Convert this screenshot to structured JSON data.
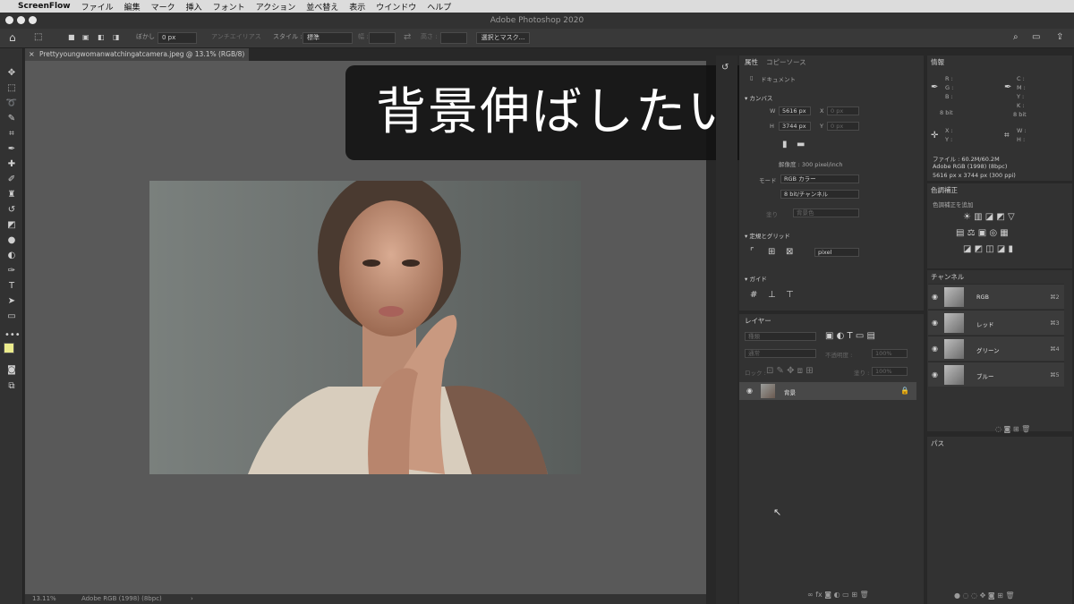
{
  "menubar": {
    "apple": "",
    "app": "ScreenFlow",
    "items": [
      "ファイル",
      "編集",
      "マーク",
      "挿入",
      "フォント",
      "アクション",
      "並べ替え",
      "表示",
      "ウインドウ",
      "ヘルプ"
    ]
  },
  "window": {
    "title": "Adobe Photoshop 2020"
  },
  "options": {
    "feather_label": "ぼかし :",
    "feather_value": "0 px",
    "antialias": "アンチエイリアス",
    "style_label": "スタイル :",
    "style_value": "標準",
    "width_label": "幅 :",
    "height_label": "高さ :",
    "mask_button": "選択とマスク..."
  },
  "document": {
    "tab": "Prettyyoungwomanwatchingatcamera.jpeg @ 13.1% (RGB/8)",
    "zoom": "13.11%",
    "profile": "Adobe RGB (1998) (8bpc)",
    "arrow": "›"
  },
  "subtitle": "背景伸ばしたい",
  "properties": {
    "tab1": "属性",
    "tab2": "コピーソース",
    "doc_label": "ドキュメント",
    "canvas_label": "カンバス",
    "w_label": "W",
    "w_value": "5616 px",
    "h_label": "H",
    "h_value": "3744 px",
    "x_label": "X",
    "x_value": "0 px",
    "y_label": "Y",
    "y_value": "0 px",
    "resolution": "解像度 : 300 pixel/inch",
    "mode_label": "モード",
    "mode_value": "RGB カラー",
    "bits_value": "8 bit/チャンネル",
    "fill_label": "塗り",
    "fill_value": "背景色",
    "rulers_title": "定規とグリッド",
    "unit_value": "pixel",
    "guides_title": "ガイド"
  },
  "info": {
    "title": "情報",
    "r": "R :",
    "g": "G :",
    "b": "B :",
    "c": "C :",
    "m": "M :",
    "y": "Y :",
    "k": "K :",
    "bit_left": "8 bit",
    "bit_right": "8 bit",
    "x": "X :",
    "y2": "Y :",
    "w": "W :",
    "h": "H :",
    "file": "ファイル : 60.2M/60.2M",
    "profile": "Adobe RGB (1998) (8bpc)",
    "dims": "5616 px x 3744 px (300 ppi)"
  },
  "adjustments": {
    "title": "色調補正",
    "add": "色調補正を追加"
  },
  "channels": {
    "title": "チャンネル",
    "rows": [
      {
        "name": "RGB",
        "key": "⌘2"
      },
      {
        "name": "レッド",
        "key": "⌘3"
      },
      {
        "name": "グリーン",
        "key": "⌘4"
      },
      {
        "name": "ブルー",
        "key": "⌘5"
      }
    ]
  },
  "paths": {
    "title": "パス"
  },
  "layers": {
    "title": "レイヤー",
    "kind": "種類",
    "blend": "通常",
    "opacity_label": "不透明度 :",
    "opacity_value": "100%",
    "lock_label": "ロック :",
    "fill_label": "塗り :",
    "fill_value": "100%",
    "layer_name": "背景"
  }
}
